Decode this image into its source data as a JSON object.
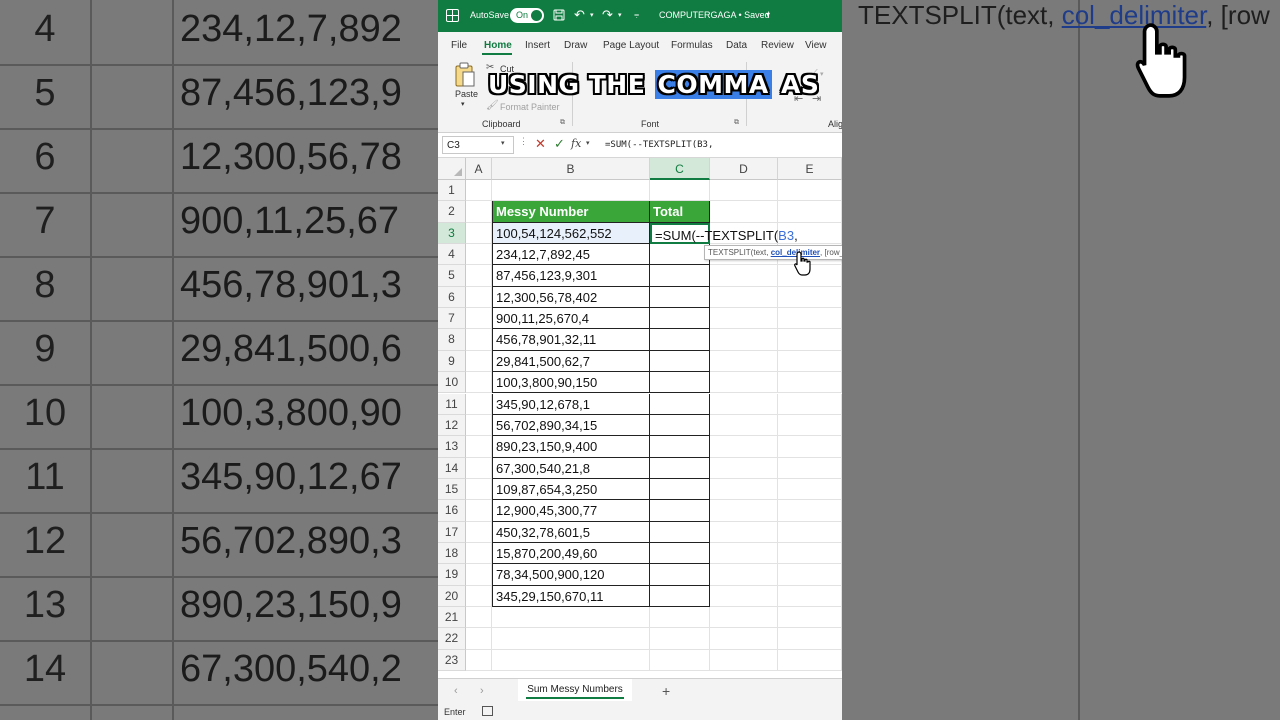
{
  "title_bar": {
    "autosave_label": "AutoSave",
    "toggle_label": "On",
    "file_title": "COMPUTERGAGA • Saved"
  },
  "menu": {
    "tabs": [
      "File",
      "Home",
      "Insert",
      "Draw",
      "Page Layout",
      "Formulas",
      "Data",
      "Review",
      "View"
    ]
  },
  "ribbon": {
    "paste_label": "Paste",
    "cut_label": "Cut",
    "format_painter_label": "Format Painter",
    "clipboard_group": "Clipboard",
    "font_group": "Font",
    "alignment_group": "Alig"
  },
  "banner": {
    "before": "USING THE",
    "highlight": "COMMA",
    "after": "AS"
  },
  "formula_bar": {
    "name_box": "C3",
    "fx_label": "fx",
    "formula": "=SUM(--TEXTSPLIT(B3,"
  },
  "grid": {
    "columns": [
      "A",
      "B",
      "C",
      "D",
      "E"
    ],
    "row_numbers": [
      "1",
      "2",
      "3",
      "4",
      "5",
      "6",
      "7",
      "8",
      "9",
      "10",
      "11",
      "12",
      "13",
      "14",
      "15",
      "16",
      "17",
      "18",
      "19",
      "20",
      "21",
      "22",
      "23"
    ],
    "header_b": "Messy Number",
    "header_c": "Total",
    "active_formula_prefix": "=SUM(--TEXTSPLIT(",
    "active_formula_ref": "B3",
    "active_formula_suffix": ",",
    "values": [
      "100,54,124,562,552",
      "234,12,7,892,45",
      "87,456,123,9,301",
      "12,300,56,78,402",
      "900,11,25,670,4",
      "456,78,901,32,11",
      "29,841,500,62,7",
      "100,3,800,90,150",
      "345,90,12,678,1",
      "56,702,890,34,15",
      "890,23,150,9,400",
      "67,300,540,21,8",
      "109,87,654,3,250",
      "12,900,45,300,77",
      "450,32,78,601,5",
      "15,870,200,49,60",
      "78,34,500,900,120",
      "345,29,150,670,11"
    ]
  },
  "tooltip": {
    "fn": "TEXTSPLIT(text, ",
    "current_arg": "col_delimiter",
    "rest": ", [row_"
  },
  "sheet_tabs": {
    "active": "Sum Messy Numbers",
    "add_label": "+"
  },
  "status": {
    "mode": "Enter"
  },
  "background": {
    "row_numbers": [
      "4",
      "5",
      "6",
      "7",
      "8",
      "9",
      "10",
      "11",
      "12",
      "13",
      "14"
    ],
    "values": [
      "234,12,7,892",
      "87,456,123,9",
      "12,300,56,78",
      "900,11,25,67",
      "456,78,901,3",
      "29,841,500,6",
      "100,3,800,90",
      "345,90,12,67",
      "56,702,890,3",
      "890,23,150,9",
      "67,300,540,2"
    ],
    "tooltip_fn": "TEXTSPLIT(text, ",
    "tooltip_arg": "col_delimiter",
    "tooltip_rest": ", [row"
  },
  "colors": {
    "excel_green": "#107c41",
    "table_header_green": "#3aa63a",
    "highlight_blue": "#3a7ee8"
  }
}
